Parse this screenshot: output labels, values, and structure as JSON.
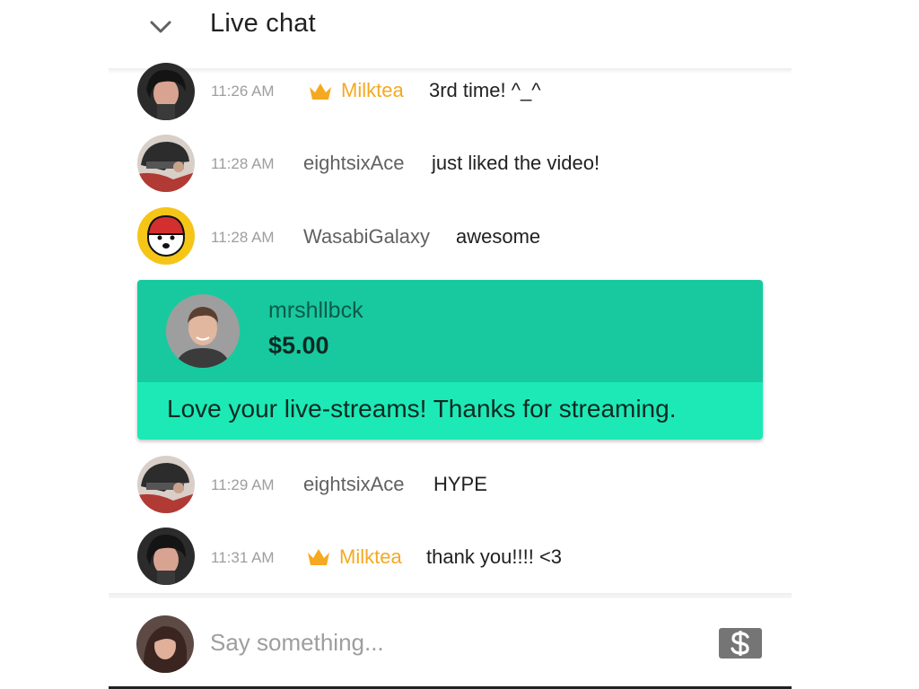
{
  "header": {
    "title": "Live chat",
    "collapse_icon": "chevron-down-icon"
  },
  "messages": [
    {
      "time": "11:26 AM",
      "author": "Milktea",
      "is_owner": true,
      "badge_icon": "crown-icon",
      "text": "3rd time! ^_^"
    },
    {
      "time": "11:28 AM",
      "author": "eightsixAce",
      "is_owner": false,
      "text": "just liked the video!"
    },
    {
      "time": "11:28 AM",
      "author": "WasabiGalaxy",
      "is_owner": false,
      "text": "awesome"
    },
    {
      "time": "11:29 AM",
      "author": "eightsixAce",
      "is_owner": false,
      "text": "HYPE"
    },
    {
      "time": "11:31 AM",
      "author": "Milktea",
      "is_owner": true,
      "badge_icon": "crown-icon",
      "text": "thank you!!!! <3"
    }
  ],
  "super_chat": {
    "author": "mrshllbck",
    "amount": "$5.00",
    "message": "Love your live-streams! Thanks for streaming.",
    "color_header": "#18c9a0",
    "color_body": "#1de9b6"
  },
  "input": {
    "placeholder": "Say something...",
    "value": "",
    "super_chat_button_icon": "dollar-icon"
  },
  "colors": {
    "owner_name": "#f4a921",
    "timestamp": "#9e9e9e",
    "author": "#616161"
  }
}
